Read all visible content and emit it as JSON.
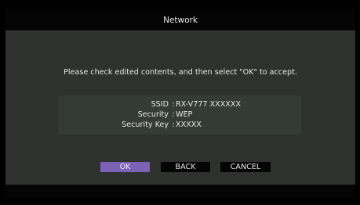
{
  "header": {
    "title": "Network"
  },
  "main": {
    "message": "Please check edited contents, and then select \"OK\" to accept.",
    "fields": [
      {
        "label": "SSID",
        "separator": ":",
        "value": "RX-V777 XXXXXX"
      },
      {
        "label": "Security",
        "separator": ":",
        "value": "WEP"
      },
      {
        "label": "Security Key",
        "separator": ":",
        "value": "XXXXX"
      }
    ]
  },
  "buttons": {
    "ok_label": "OK",
    "back_label": "BACK",
    "cancel_label": "CANCEL",
    "selected": "OK"
  },
  "colors": {
    "selected_button": "#7b62b4",
    "content_background": "#2f312f",
    "info_panel": "#343a34",
    "text": "#e6e6e6"
  }
}
